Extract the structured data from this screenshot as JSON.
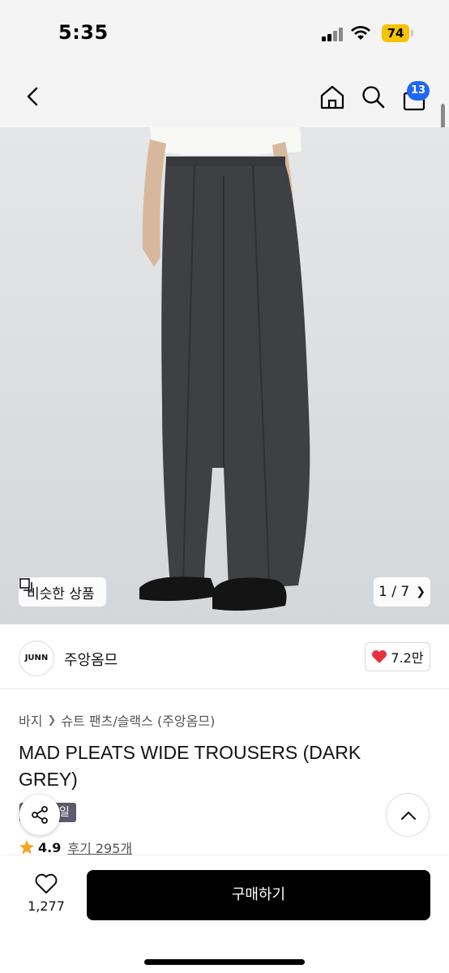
{
  "status_bar": {
    "time": "5:35",
    "battery": "74"
  },
  "nav": {
    "back_icon": "chevron-left-icon",
    "home_icon": "home-icon",
    "search_icon": "search-icon",
    "cart_icon": "shopping-bag-icon",
    "cart_count": "13"
  },
  "gallery": {
    "similar_label": "비슷한 상품",
    "page_indicator": "1 / 7"
  },
  "brand": {
    "logo_text": "JUNN",
    "name": "주앙옴므",
    "likes": "7.2만",
    "like_color": "#e8313f"
  },
  "breadcrumb": {
    "category": "바지",
    "subcategory": "슈트 팬츠/슬랙스 (주앙옴므)"
  },
  "product": {
    "title": "MAD PLEATS WIDE TROUSERS (DARK GREY)",
    "sale_tag": "세일",
    "rating": "4.9",
    "reviews": "후기 295개",
    "star_color": "#f5a623"
  },
  "bottom_bar": {
    "wish_count": "1,277",
    "buy_label": "구매하기"
  }
}
